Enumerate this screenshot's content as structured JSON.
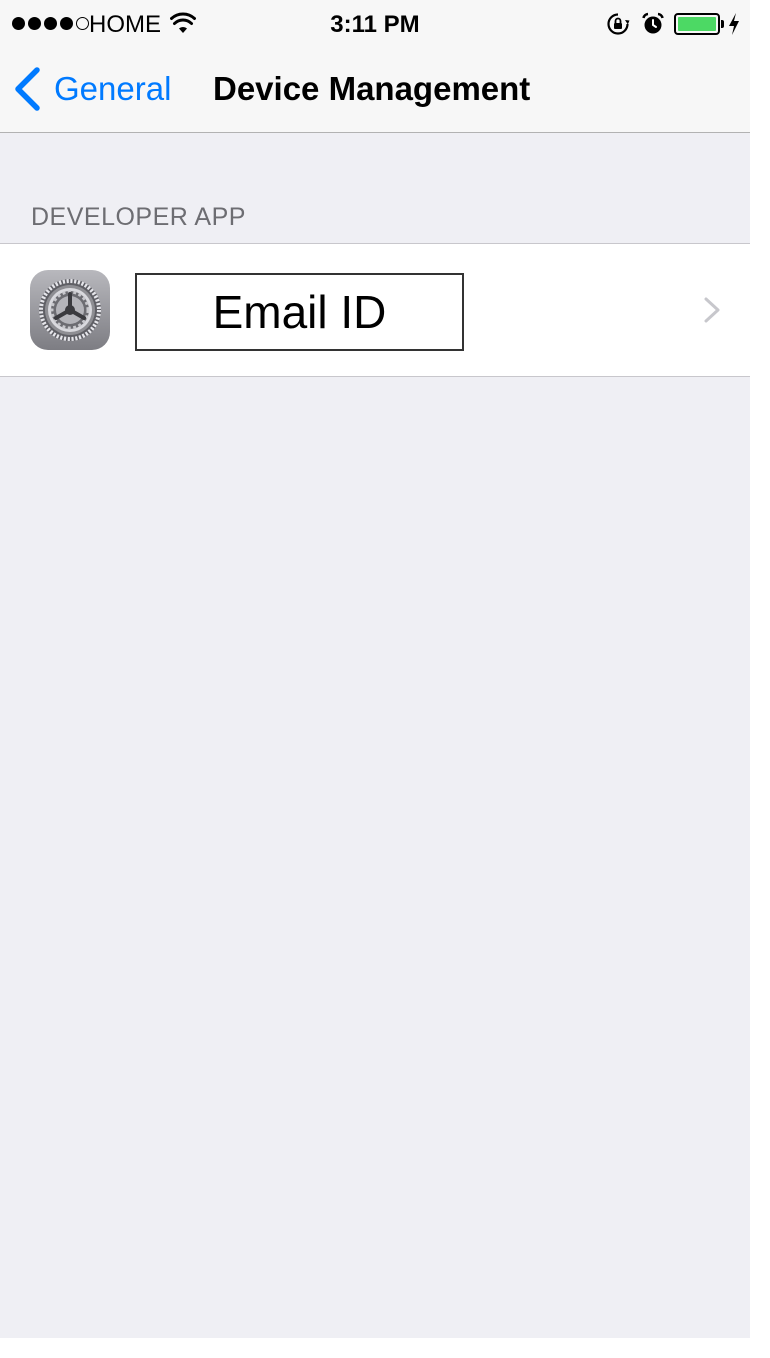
{
  "statusbar": {
    "carrier": "HOME",
    "time": "3:11 PM",
    "battery_level": 1.0,
    "battery_color": "#4cd964",
    "icons": [
      "wifi-icon",
      "orientation-lock-icon",
      "alarm-icon",
      "battery-icon",
      "charging-bolt-icon"
    ]
  },
  "navbar": {
    "back_label": "General",
    "title": "Device Management",
    "accent_color": "#007aff"
  },
  "section": {
    "header": "DEVELOPER APP",
    "items": [
      {
        "label": "Email ID",
        "icon": "settings-gear-icon"
      }
    ]
  }
}
